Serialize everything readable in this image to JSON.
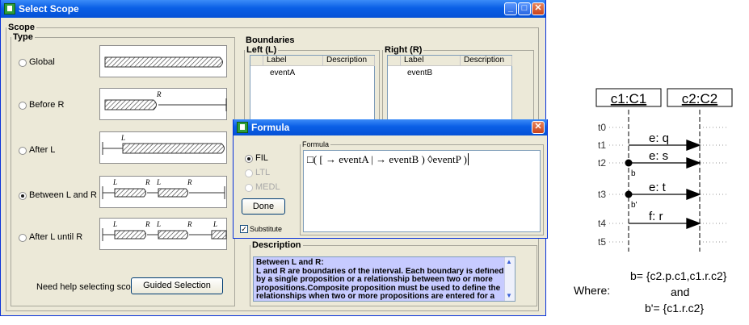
{
  "window": {
    "title": "Select Scope"
  },
  "scope": {
    "legend": "Scope",
    "type_legend": "Type"
  },
  "types": [
    {
      "label": "Global",
      "selected": false
    },
    {
      "label": "Before R",
      "selected": false
    },
    {
      "label": "After L",
      "selected": false
    },
    {
      "label": "Between L and R",
      "selected": true
    },
    {
      "label": "After L until R",
      "selected": false
    }
  ],
  "help": {
    "text": "Need help selecting scope?",
    "button": "Guided Selection"
  },
  "boundaries": {
    "legend": "Boundaries",
    "left": {
      "legend": "Left (L)",
      "col_label": "Label",
      "col_desc": "Description",
      "rows": [
        "eventA"
      ]
    },
    "right": {
      "legend": "Right (R)",
      "col_label": "Label",
      "col_desc": "Description",
      "rows": [
        "eventB"
      ]
    }
  },
  "formula": {
    "title": "Formula",
    "group": "Formula",
    "options": [
      {
        "label": "FIL",
        "selected": true,
        "enabled": true
      },
      {
        "label": "LTL",
        "selected": false,
        "enabled": false
      },
      {
        "label": "MEDL",
        "selected": false,
        "enabled": false
      }
    ],
    "done": "Done",
    "substitute": "Substitute",
    "substitute_checked": true,
    "expression": "□( [ → eventA | → eventB ) ◊eventP )"
  },
  "description": {
    "legend": "Description",
    "heading": "Between L and R:",
    "text": "L and R are boundaries of the interval. Each boundary is defined by a single proposition or a relationship between two or more propositions.Composite proposition must be used to define the relationships when two or more propositions are entered for a"
  },
  "diagram": {
    "objects": [
      "c1:C1",
      "c2:C2"
    ],
    "times": [
      "t0",
      "t1",
      "t2",
      "t3",
      "t4",
      "t5"
    ],
    "messages": [
      "e: q",
      "e: s",
      "e: t",
      "f: r"
    ],
    "marks": [
      "b",
      "b'"
    ],
    "where": "Where:",
    "b_def": "b= {c2.p.c1,c1.r.c2}",
    "and": "and",
    "bp_def": "b'= {c1.r.c2}"
  }
}
